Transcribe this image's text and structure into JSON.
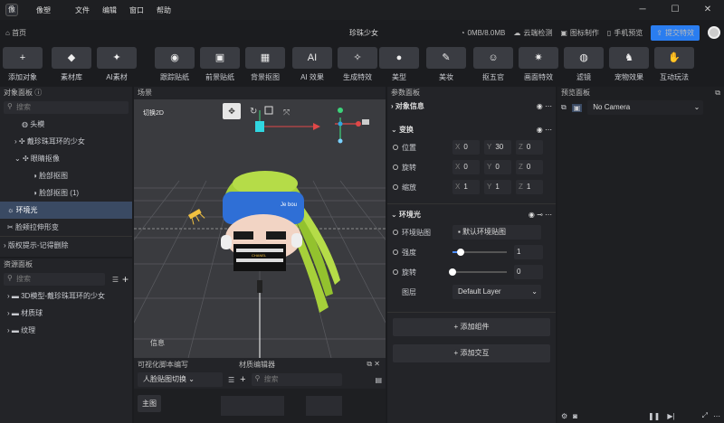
{
  "app": {
    "logo": "像",
    "title": "像塑",
    "menu": [
      "文件",
      "编辑",
      "窗口",
      "帮助"
    ]
  },
  "nav": {
    "home": "首页",
    "project": "珍珠少女",
    "memory": "0MB/8.0MB",
    "cloud": "云端检测",
    "icon": "图标制作",
    "phone": "手机预览",
    "submit": "提交特效"
  },
  "toolbar": [
    {
      "icon": "plus-icon",
      "glyph": "+",
      "label": "添加对象"
    },
    {
      "icon": "cube-icon",
      "glyph": "◆",
      "label": "素材库"
    },
    {
      "icon": "ai-material-icon",
      "glyph": "✦",
      "label": "AI素材"
    },
    {
      "icon": "sticker-icon",
      "glyph": "◉",
      "label": "跟踪贴纸"
    },
    {
      "icon": "foreground-sticker-icon",
      "glyph": "▣",
      "label": "前景贴纸"
    },
    {
      "icon": "background-icon",
      "glyph": "▦",
      "label": "背景抠图"
    },
    {
      "icon": "ai-effect-icon",
      "glyph": "AI",
      "label": "AI 效果"
    },
    {
      "icon": "generate-icon",
      "glyph": "✧",
      "label": "生成特效"
    },
    {
      "icon": "beauty-icon",
      "glyph": "●",
      "label": "美型"
    },
    {
      "icon": "makeup-icon",
      "glyph": "✎",
      "label": "美妆"
    },
    {
      "icon": "face-icon",
      "glyph": "☺",
      "label": "抠五官"
    },
    {
      "icon": "screen-effect-icon",
      "glyph": "✷",
      "label": "画面特效"
    },
    {
      "icon": "filter-icon",
      "glyph": "◍",
      "label": "滤镜"
    },
    {
      "icon": "pet-icon",
      "glyph": "♞",
      "label": "宠物效果"
    },
    {
      "icon": "interactive-icon",
      "glyph": "✋",
      "label": "互动玩法"
    }
  ],
  "objects": {
    "title": "对象面板",
    "search": "搜索",
    "items": [
      "头模",
      "戴珍珠耳环的少女",
      "眼睛抠像",
      "脸部抠图",
      "脸部抠图 (1)",
      "环境光",
      "脸颊拉伸形变"
    ],
    "hint": "版权提示-记得删除"
  },
  "resources": {
    "title": "资源面板",
    "search": "搜索",
    "items": [
      "3D模型-戴珍珠耳环的少女",
      "材质球",
      "纹理"
    ]
  },
  "scene": {
    "title": "场景",
    "mode": "切换2D",
    "info": "信息",
    "hat_text": "Je bou",
    "glasses_text": "CHANEL"
  },
  "bottom": {
    "tab1": "可视化脚本编写",
    "tab2": "材质编辑器",
    "select": "人脸贴图切换",
    "search": "搜索",
    "main": "主图"
  },
  "params": {
    "title": "参数面板",
    "object_info": "对象信息",
    "transform": "变换",
    "position": "位置",
    "rotation": "旋转",
    "scale": "缩放",
    "pos": [
      "0",
      "30",
      "0"
    ],
    "rot": [
      "0",
      "0",
      "0"
    ],
    "scl": [
      "1",
      "1",
      "1"
    ],
    "ambient": "环境光",
    "env_map": "环境贴图",
    "env_value": "默认环境贴图",
    "intensity": "强度",
    "intensity_value": "1",
    "intensity_level": 0.15,
    "rotate": "旋转",
    "rotate_value": "0",
    "rotate_level": 0.0,
    "layer": "图层",
    "layer_value": "Default Layer",
    "add_component": "添加组件",
    "add_interaction": "添加交互"
  },
  "preview": {
    "title": "预览面板",
    "camera": "No Camera"
  },
  "colors": {
    "accent": "#2a7df0",
    "selection": "#3a4a63",
    "hat": "#2f6fd6",
    "hair": "#a6d03a"
  }
}
